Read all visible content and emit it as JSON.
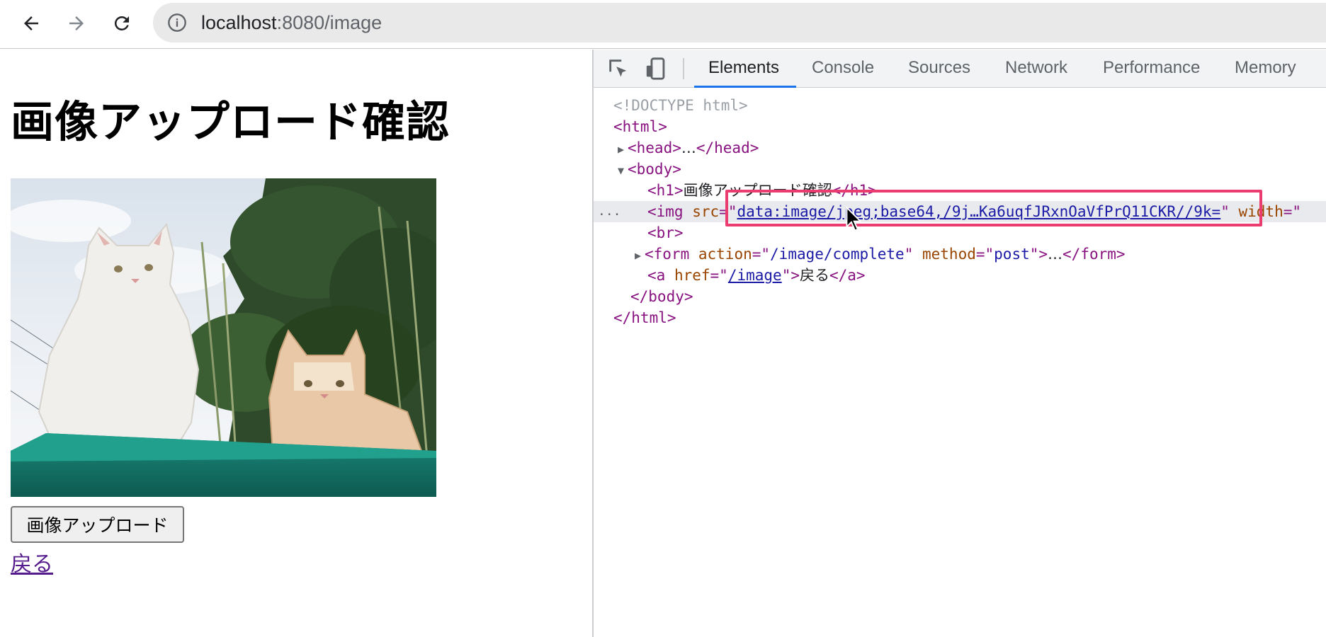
{
  "browser": {
    "url_host": "localhost",
    "url_rest": ":8080/image",
    "back_icon": "arrow-left-icon",
    "forward_icon": "arrow-right-icon",
    "reload_icon": "reload-icon",
    "info_icon": "info-icon"
  },
  "page": {
    "title": "画像アップロード確認",
    "image_alt": "cats",
    "upload_button": "画像アップロード",
    "back_link": "戻る"
  },
  "devtools": {
    "tabs": [
      "Elements",
      "Console",
      "Sources",
      "Network",
      "Performance",
      "Memory"
    ],
    "active_tab": "Elements",
    "tree": {
      "doctype": "<!DOCTYPE html>",
      "html_open": "<html>",
      "head_open": "<head>",
      "head_ellipsis": "…",
      "head_close": "</head>",
      "body_open": "<body>",
      "h1_open": "<h1>",
      "h1_text": "画像アップロード確認",
      "h1_close": "</h1>",
      "img_open": "<img",
      "img_src_attr": "src",
      "img_src_value": "data:image/jpeg;base64,/9j…Ka6uqfJRxnOaVfPrQ11CKR//9k=",
      "img_width_attr": "width",
      "br": "<br>",
      "form_open": "<form",
      "form_action_attr": "action",
      "form_action_value": "/image/complete",
      "form_method_attr": "method",
      "form_method_value": "post",
      "form_ellipsis": "…",
      "form_close": "</form>",
      "a_open": "<a",
      "a_href_attr": "href",
      "a_href_value": "/image",
      "a_text": "戻る",
      "a_close": "</a>",
      "body_close": "</body>",
      "html_close": "</html>",
      "selected_dots": "..."
    }
  },
  "colors": {
    "highlight": "#ea3c6e",
    "active_tab_underline": "#1a73e8"
  }
}
